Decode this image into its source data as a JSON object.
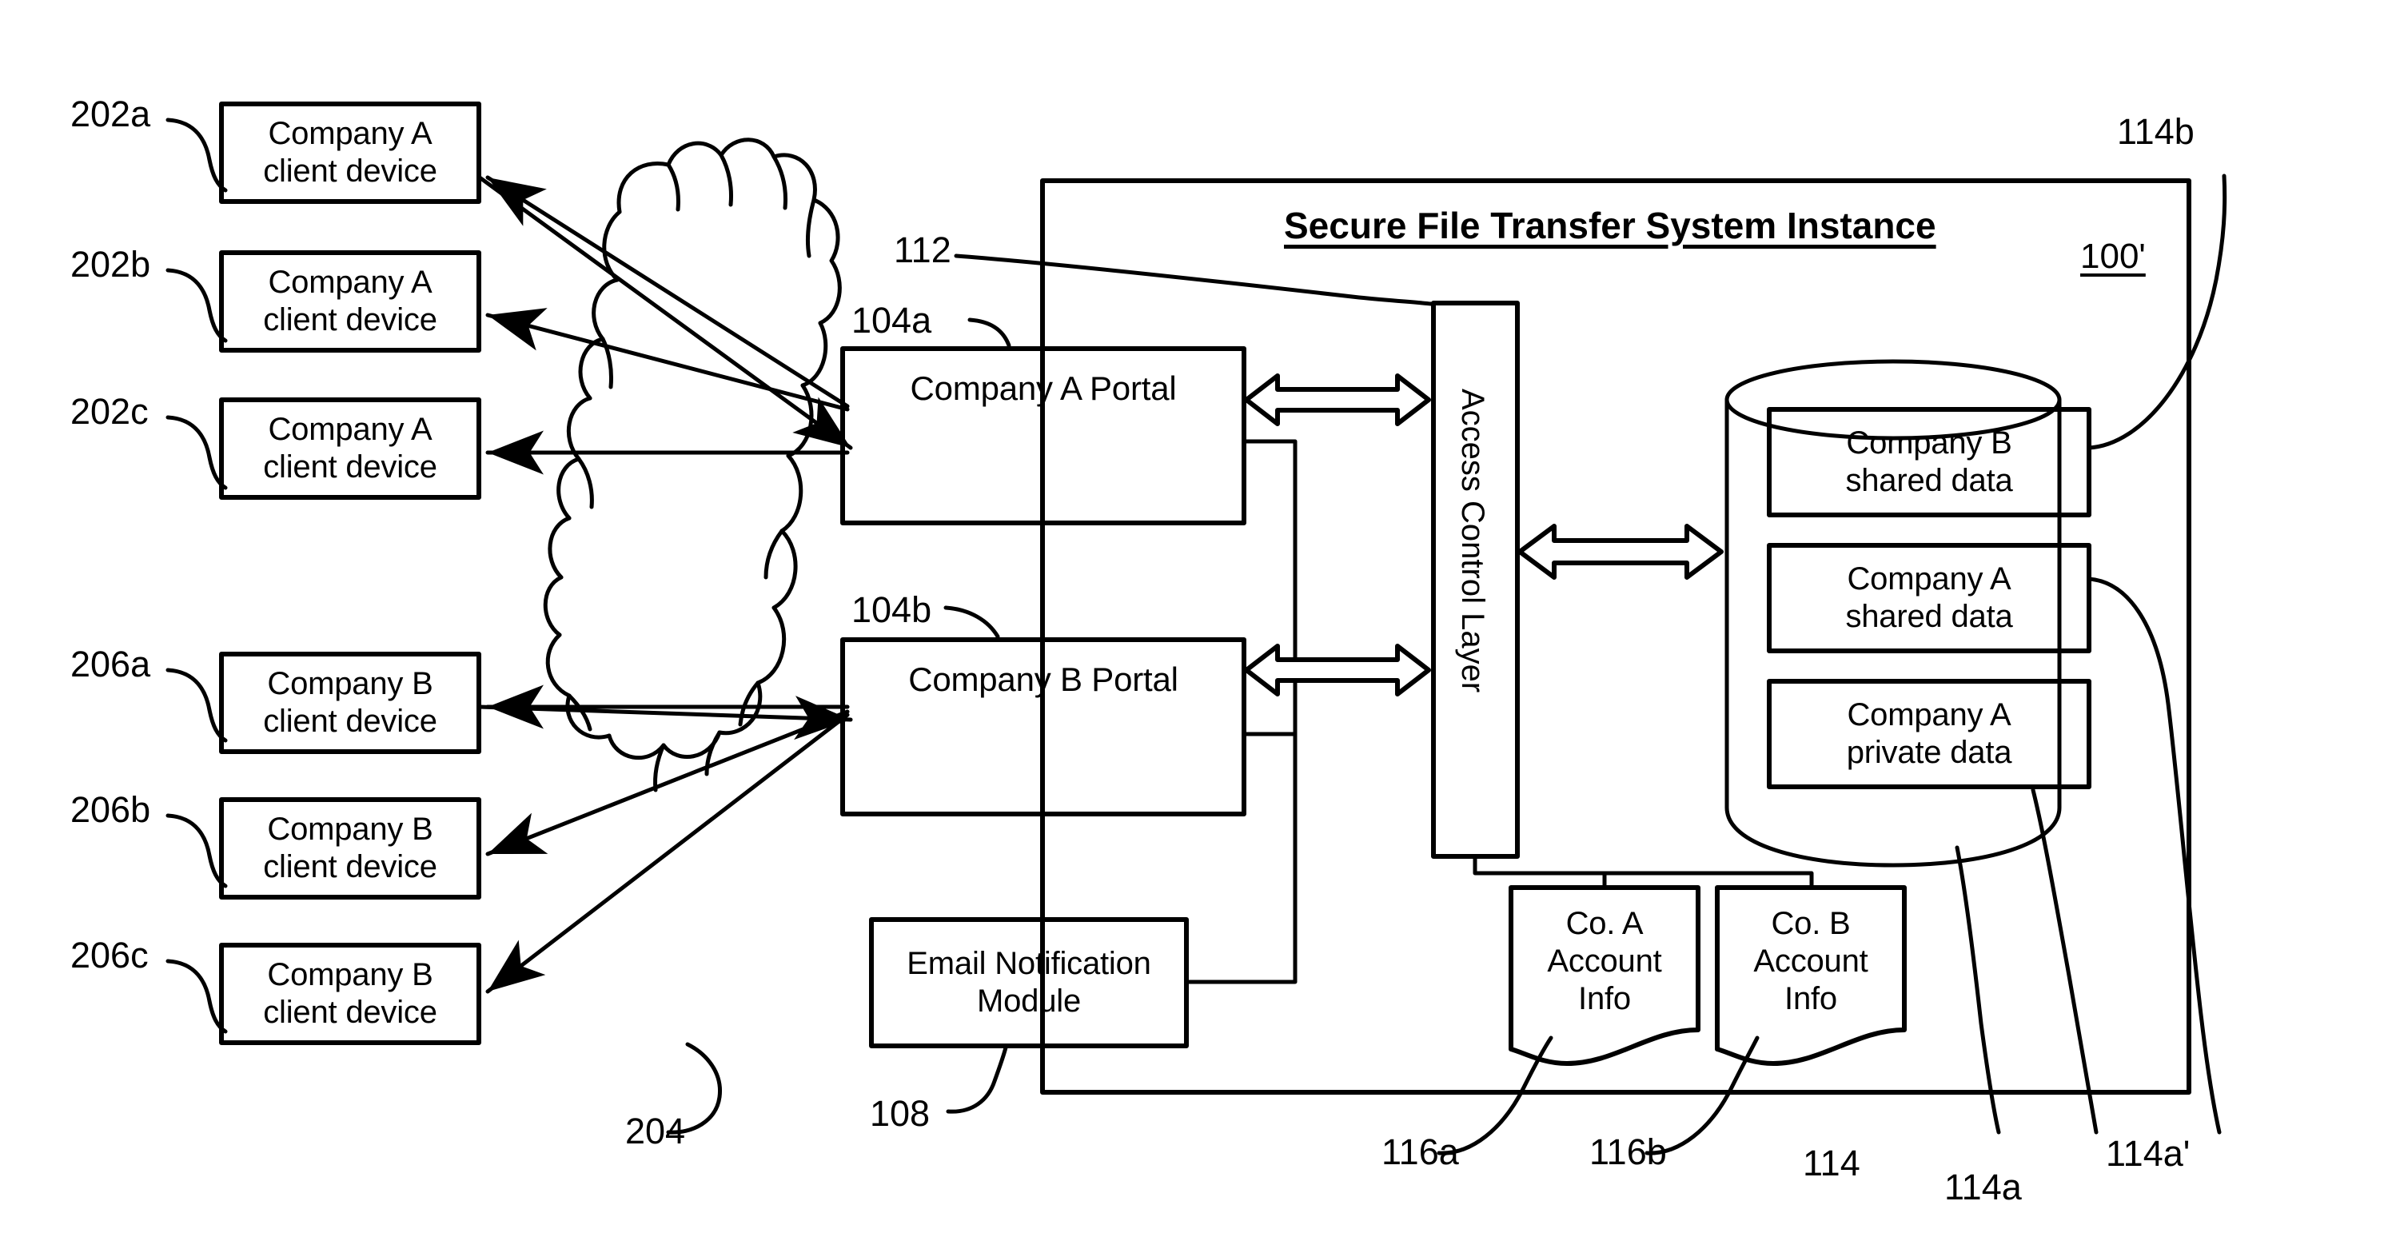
{
  "figure": {
    "title": "Secure File Transfer System Instance",
    "system_ref": "100'"
  },
  "clients": {
    "company_a": [
      {
        "ref": "202a",
        "label": "Company A\nclient device"
      },
      {
        "ref": "202b",
        "label": "Company A\nclient device"
      },
      {
        "ref": "202c",
        "label": "Company A\nclient device"
      }
    ],
    "company_b": [
      {
        "ref": "206a",
        "label": "Company B\nclient device"
      },
      {
        "ref": "206b",
        "label": "Company B\nclient device"
      },
      {
        "ref": "206c",
        "label": "Company B\nclient device"
      }
    ]
  },
  "network": {
    "ref": "204",
    "shape": "cloud-icon"
  },
  "portals": [
    {
      "ref": "104a",
      "label": "Company A Portal"
    },
    {
      "ref": "104b",
      "label": "Company B Portal"
    }
  ],
  "email_module": {
    "ref": "108",
    "label": "Email Notification\nModule"
  },
  "access_control": {
    "ref": "112",
    "label": "Access Control Layer"
  },
  "database": {
    "ref": "114",
    "partitions": [
      {
        "ref": "114b",
        "label": "Company B\nshared data"
      },
      {
        "ref": "114a",
        "label": "Company A\nshared data"
      },
      {
        "ref": "114a'",
        "label": "Company A\nprivate data"
      }
    ]
  },
  "account_info": [
    {
      "ref": "116a",
      "label": "Co. A\nAccount\nInfo"
    },
    {
      "ref": "116b",
      "label": "Co. B\nAccount\nInfo"
    }
  ],
  "reference_numerals": {
    "r202a": "202a",
    "r202b": "202b",
    "r202c": "202c",
    "r206a": "206a",
    "r206b": "206b",
    "r206c": "206c",
    "r204": "204",
    "r104a": "104a",
    "r104b": "104b",
    "r108": "108",
    "r112": "112",
    "r114": "114",
    "r114a": "114a",
    "r114aprime": "114a'",
    "r114b": "114b",
    "r116a": "116a",
    "r116b": "116b",
    "r100prime": "100'"
  },
  "colors": {
    "stroke": "#000000",
    "background": "#ffffff"
  }
}
